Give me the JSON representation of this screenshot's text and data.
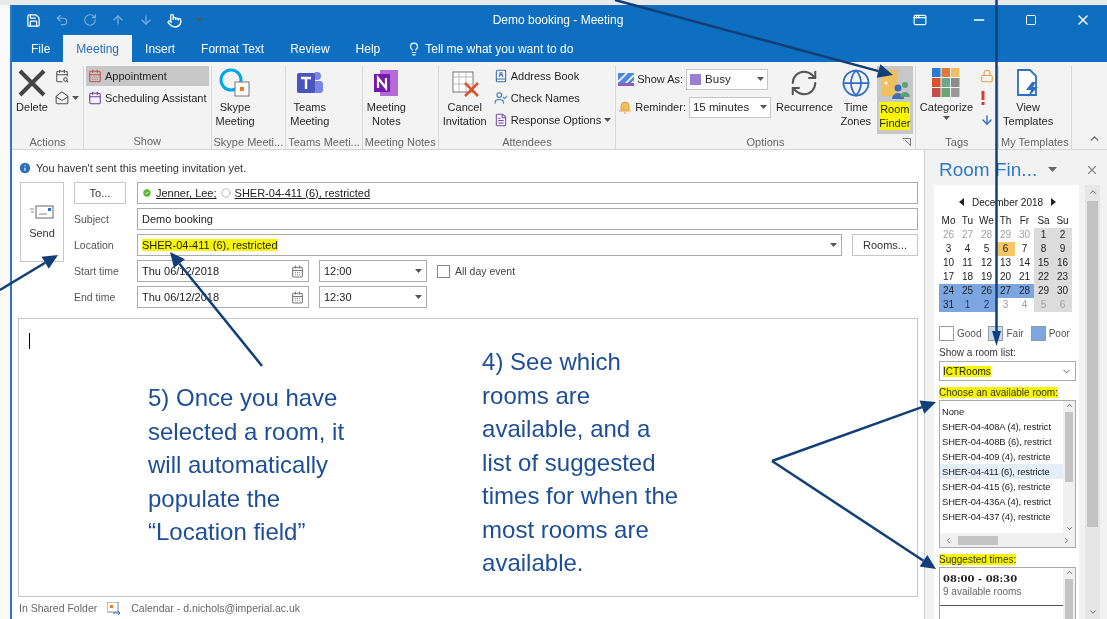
{
  "window": {
    "title": "Demo booking  -  Meeting"
  },
  "tabs": [
    {
      "label": "File",
      "selected": false
    },
    {
      "label": "Meeting",
      "selected": true
    },
    {
      "label": "Insert",
      "selected": false
    },
    {
      "label": "Format Text",
      "selected": false
    },
    {
      "label": "Review",
      "selected": false
    },
    {
      "label": "Help",
      "selected": false
    }
  ],
  "tell_me": {
    "placeholder": "Tell me what you want to do"
  },
  "ribbon": [
    {
      "label": "Actions",
      "items": [
        {
          "kind": "delete",
          "label": "Delete"
        },
        {
          "kind": "calendar-search"
        },
        {
          "kind": "forward"
        }
      ]
    },
    {
      "label": "Show",
      "items": [
        {
          "kind": "appointment",
          "label": "Appointment",
          "selected": true
        },
        {
          "kind": "scheduling-assistant",
          "label": "Scheduling Assistant",
          "selected": false
        }
      ]
    },
    {
      "label": "Skype Meeti...",
      "items": [
        {
          "kind": "skype-meeting",
          "label": "Skype Meeting"
        }
      ]
    },
    {
      "label": "Teams Meeti...",
      "items": [
        {
          "kind": "teams-meeting",
          "label": "Teams Meeting"
        }
      ]
    },
    {
      "label": "Meeting Notes",
      "items": [
        {
          "kind": "meeting-notes",
          "label": "Meeting Notes"
        }
      ]
    },
    {
      "label": "Attendees",
      "items": [
        {
          "kind": "cancel-invitation",
          "label": "Cancel Invitation"
        },
        {
          "kind": "address-book",
          "label": "Address Book"
        },
        {
          "kind": "check-names",
          "label": "Check Names"
        },
        {
          "kind": "response-options",
          "label": "Response Options"
        }
      ]
    },
    {
      "label": "Options",
      "launcher": true,
      "items": [
        {
          "kind": "show-as",
          "label": "Show As:",
          "value": "Busy"
        },
        {
          "kind": "reminder",
          "label": "Reminder:",
          "value": "15 minutes"
        },
        {
          "kind": "recurrence",
          "label": "Recurrence"
        },
        {
          "kind": "time-zones",
          "label": "Time Zones"
        },
        {
          "kind": "room-finder",
          "label": "Room Finder",
          "selected": true,
          "highlighted": true
        }
      ]
    },
    {
      "label": "Tags",
      "items": [
        {
          "kind": "categorize",
          "label": "Categorize"
        },
        {
          "kind": "private"
        },
        {
          "kind": "high-importance"
        },
        {
          "kind": "low-importance"
        }
      ]
    },
    {
      "label": "My Templates",
      "items": [
        {
          "kind": "view-templates",
          "label": "View Templates"
        }
      ]
    }
  ],
  "info_bar": "You haven't sent this meeting invitation yet.",
  "send_button": "Send",
  "to_button": "To...",
  "recipients": [
    {
      "name": "Jenner, Lee;",
      "accepted": true
    },
    {
      "name": "SHER-04-411 (6), restricted",
      "accepted": false
    }
  ],
  "subject": {
    "label": "Subject",
    "value": "Demo booking"
  },
  "location": {
    "label": "Location",
    "value": "SHER-04-411 (6), restricted",
    "highlighted": true
  },
  "rooms_button": "Rooms...",
  "start": {
    "label": "Start time",
    "date": "Thu 06/12/2018",
    "time": "12:00"
  },
  "end": {
    "label": "End time",
    "date": "Thu 06/12/2018",
    "time": "12:30"
  },
  "all_day": {
    "label": "All day event",
    "checked": false
  },
  "body_notes": [
    "5) Once you have\nselected a room, it\nwill automatically\npopulate the\n“Location field”",
    "4) See which\nrooms are\navailable, and a\nlist of suggested\ntimes for when the\nmost rooms are\navailable."
  ],
  "status_bar": {
    "folder": "In Shared Folder",
    "calendar": "Calendar - d.nichols@imperial.ac.uk"
  },
  "room_finder": {
    "title": "Room Fin...",
    "month": "December 2018",
    "weekdays": [
      "Mo",
      "Tu",
      "We",
      "Th",
      "Fr",
      "Sa",
      "Su"
    ],
    "weeks": [
      [
        {
          "day": "26",
          "kind": "plain",
          "outside": true
        },
        {
          "day": "27",
          "kind": "plain",
          "outside": true
        },
        {
          "day": "28",
          "kind": "plain",
          "outside": true
        },
        {
          "day": "29",
          "kind": "plain",
          "outside": true
        },
        {
          "day": "30",
          "kind": "plain",
          "outside": true
        },
        {
          "day": "1",
          "kind": "weekend",
          "outside": false
        },
        {
          "day": "2",
          "kind": "weekend",
          "outside": false
        }
      ],
      [
        {
          "day": "3",
          "kind": "plain",
          "outside": false
        },
        {
          "day": "4",
          "kind": "plain",
          "outside": false
        },
        {
          "day": "5",
          "kind": "plain",
          "outside": false
        },
        {
          "day": "6",
          "kind": "today",
          "outside": false
        },
        {
          "day": "7",
          "kind": "plain",
          "outside": false
        },
        {
          "day": "8",
          "kind": "weekend",
          "outside": false
        },
        {
          "day": "9",
          "kind": "weekend",
          "outside": false
        }
      ],
      [
        {
          "day": "10",
          "kind": "plain",
          "outside": false
        },
        {
          "day": "11",
          "kind": "plain",
          "outside": false
        },
        {
          "day": "12",
          "kind": "plain",
          "outside": false
        },
        {
          "day": "13",
          "kind": "plain",
          "outside": false
        },
        {
          "day": "14",
          "kind": "plain",
          "outside": false
        },
        {
          "day": "15",
          "kind": "weekend",
          "outside": false
        },
        {
          "day": "16",
          "kind": "weekend",
          "outside": false
        }
      ],
      [
        {
          "day": "17",
          "kind": "plain",
          "outside": false
        },
        {
          "day": "18",
          "kind": "plain",
          "outside": false
        },
        {
          "day": "19",
          "kind": "plain",
          "outside": false
        },
        {
          "day": "20",
          "kind": "plain",
          "outside": false
        },
        {
          "day": "21",
          "kind": "plain",
          "outside": false
        },
        {
          "day": "22",
          "kind": "weekend",
          "outside": false
        },
        {
          "day": "23",
          "kind": "weekend",
          "outside": false
        }
      ],
      [
        {
          "day": "24",
          "kind": "poor",
          "outside": false
        },
        {
          "day": "25",
          "kind": "poor",
          "outside": false
        },
        {
          "day": "26",
          "kind": "poor",
          "outside": false
        },
        {
          "day": "27",
          "kind": "poor",
          "outside": false
        },
        {
          "day": "28",
          "kind": "poor",
          "outside": false
        },
        {
          "day": "29",
          "kind": "weekend",
          "outside": false
        },
        {
          "day": "30",
          "kind": "weekend",
          "outside": false
        }
      ],
      [
        {
          "day": "31",
          "kind": "poor",
          "outside": false
        },
        {
          "day": "1",
          "kind": "poor",
          "outside": true
        },
        {
          "day": "2",
          "kind": "poor",
          "outside": true
        },
        {
          "day": "3",
          "kind": "plain",
          "outside": true
        },
        {
          "day": "4",
          "kind": "plain",
          "outside": true
        },
        {
          "day": "5",
          "kind": "weekend",
          "outside": true
        },
        {
          "day": "6",
          "kind": "weekend",
          "outside": true
        }
      ]
    ],
    "legend": [
      {
        "label": "Good",
        "color": "#ffffff"
      },
      {
        "label": "Fair",
        "color": "#c6dcf6"
      },
      {
        "label": "Poor",
        "color": "#7ca6e0"
      }
    ],
    "room_list_label": "Show a room list:",
    "room_list": {
      "value": "ICTRooms",
      "highlighted": true
    },
    "rooms_label": {
      "text": "Choose an available room:",
      "highlighted": true
    },
    "rooms": [
      {
        "name": "None",
        "selected": false
      },
      {
        "name": "SHER-04-408A (4), restrict",
        "selected": false
      },
      {
        "name": "SHER-04-408B (6), restrict",
        "selected": false
      },
      {
        "name": "SHER-04-409 (4), restricte",
        "selected": false
      },
      {
        "name": "SHER-04-411 (6), restricte",
        "selected": true
      },
      {
        "name": "SHER-04-415 (6), restricte",
        "selected": false
      },
      {
        "name": "SHER-04-436A (4), restrict",
        "selected": false
      },
      {
        "name": "SHER-04-437 (4), restricte",
        "selected": false
      }
    ],
    "suggested_label": {
      "text": "Suggested times:",
      "highlighted": true
    },
    "suggestions": [
      {
        "time": "08:00 - 08:30",
        "detail": "9 available rooms"
      }
    ]
  }
}
